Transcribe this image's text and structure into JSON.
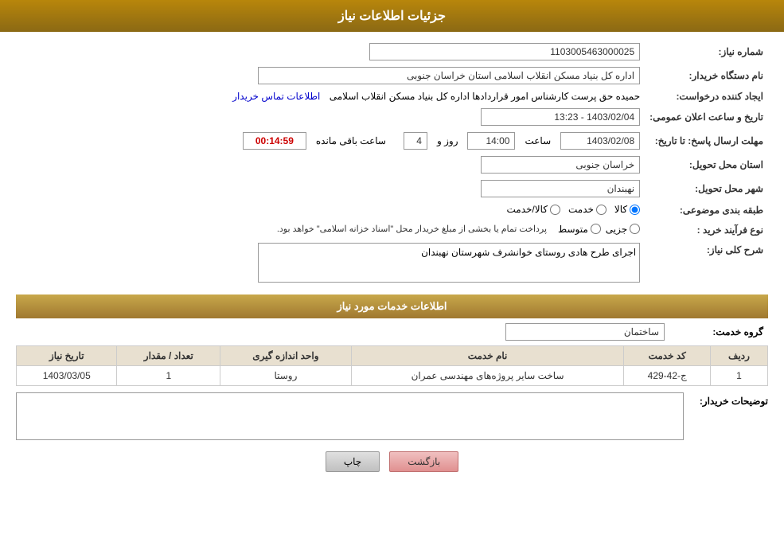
{
  "header": {
    "title": "جزئیات اطلاعات نیاز"
  },
  "fields": {
    "need_number_label": "شماره نیاز:",
    "need_number_value": "1103005463000025",
    "buyer_org_label": "نام دستگاه خریدار:",
    "buyer_org_value": "اداره کل بنیاد مسکن انقلاب اسلامی استان خراسان جنوبی",
    "creator_label": "ایجاد کننده درخواست:",
    "creator_value": "حمیده حق پرست کارشناس امور قراردادها اداره کل بنیاد مسکن انقلاب اسلامی",
    "creator_link": "اطلاعات تماس خریدار",
    "announce_date_label": "تاریخ و ساعت اعلان عمومی:",
    "announce_date_value": "1403/02/04 - 13:23",
    "response_deadline_label": "مهلت ارسال پاسخ: تا تاریخ:",
    "response_date": "1403/02/08",
    "response_time": "14:00",
    "response_days": "4",
    "response_remaining": "00:14:59",
    "response_days_label": "روز و",
    "response_remaining_label": "ساعت باقی مانده",
    "province_label": "استان محل تحویل:",
    "province_value": "خراسان جنوبی",
    "city_label": "شهر محل تحویل:",
    "city_value": "نهبندان",
    "category_label": "طبقه بندی موضوعی:",
    "category_options": [
      {
        "label": "کالا",
        "value": "kala",
        "checked": true
      },
      {
        "label": "خدمت",
        "value": "khedmat",
        "checked": false
      },
      {
        "label": "کالا/خدمت",
        "value": "kala_khedmat",
        "checked": false
      }
    ],
    "purchase_type_label": "نوع فرآیند خرید :",
    "purchase_type_options": [
      {
        "label": "جزیی",
        "value": "jozyi",
        "checked": false
      },
      {
        "label": "متوسط",
        "value": "motavaset",
        "checked": false
      }
    ],
    "purchase_type_note": "پرداخت تمام یا بخشی از مبلغ خریدار محل \"اسناد خزانه اسلامی\" خواهد بود.",
    "general_desc_label": "شرح کلی نیاز:",
    "general_desc_value": "اجرای طرح هادی روستای خوانشرف شهرستان نهبندان"
  },
  "services_section": {
    "title": "اطلاعات خدمات مورد نیاز",
    "service_group_label": "گروه خدمت:",
    "service_group_value": "ساختمان",
    "table_headers": [
      "ردیف",
      "کد خدمت",
      "نام خدمت",
      "واحد اندازه گیری",
      "تعداد / مقدار",
      "تاریخ نیاز"
    ],
    "table_rows": [
      {
        "row_num": "1",
        "service_code": "ج-42-429",
        "service_name": "ساخت سایر پروژه‌های مهندسی عمران",
        "unit": "روستا",
        "quantity": "1",
        "date": "1403/03/05"
      }
    ]
  },
  "buyer_desc_label": "توضیحات خریدار:",
  "buyer_desc_value": "",
  "buttons": {
    "print": "چاپ",
    "back": "بازگشت"
  }
}
